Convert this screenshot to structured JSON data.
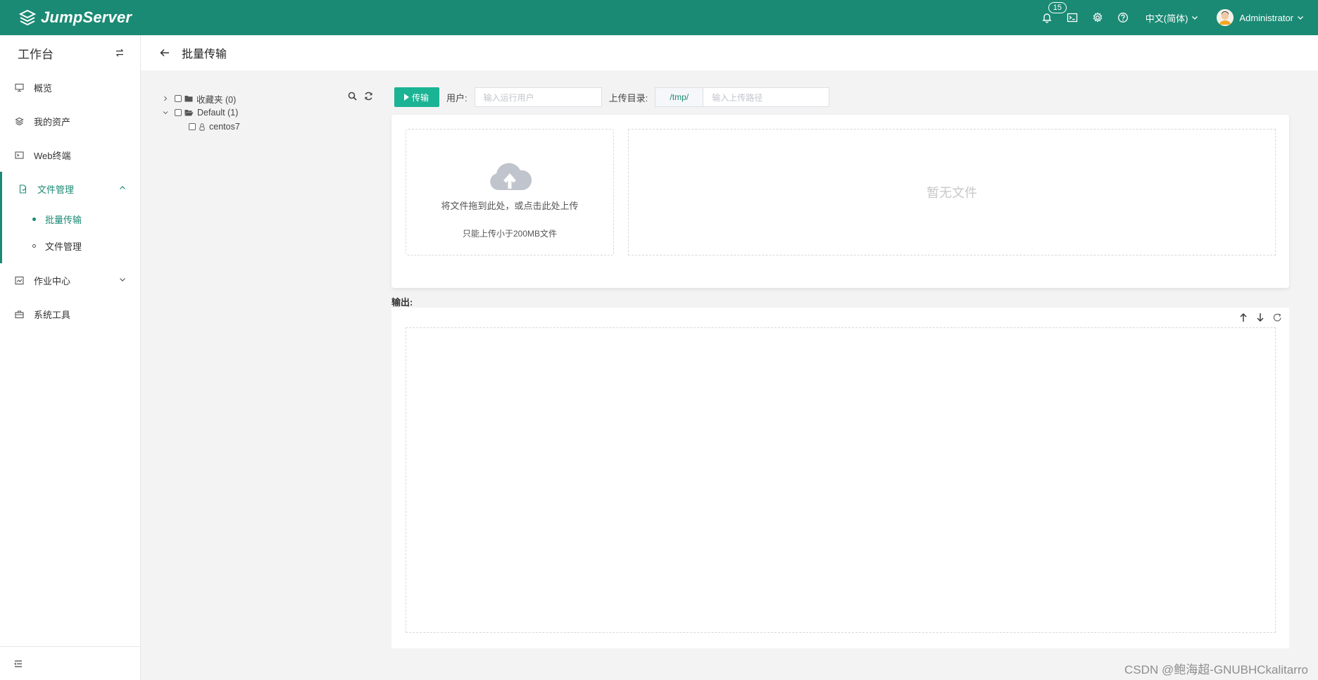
{
  "header": {
    "brand": "JumpServer",
    "notification_count": "15",
    "language": "中文(简体)",
    "username": "Administrator",
    "icons": [
      "bell-icon",
      "terminal-icon",
      "gear-icon",
      "help-icon"
    ],
    "bg_color": "#1a8a74"
  },
  "sidebar": {
    "workspace_title": "工作台",
    "items": [
      {
        "label": "概览",
        "icon": "monitor-icon"
      },
      {
        "label": "我的资产",
        "icon": "layers-icon"
      },
      {
        "label": "Web终端",
        "icon": "terminal-icon"
      },
      {
        "label": "文件管理",
        "icon": "file-icon",
        "expanded": true,
        "children": [
          {
            "label": "批量传输",
            "active": true
          },
          {
            "label": "文件管理",
            "active": false
          }
        ]
      },
      {
        "label": "作业中心",
        "icon": "job-icon"
      },
      {
        "label": "系统工具",
        "icon": "toolbox-icon"
      }
    ]
  },
  "page": {
    "title": "批量传输"
  },
  "tree": {
    "nodes": [
      {
        "label": "收藏夹 (0)",
        "expanded": false
      },
      {
        "label": "Default (1)",
        "expanded": true
      },
      {
        "label": "centos7",
        "type": "linux-asset"
      }
    ]
  },
  "toolbar": {
    "transfer_button": "传输",
    "user_label": "用户:",
    "user_placeholder": "输入运行用户",
    "dir_label": "上传目录:",
    "dir_prefix": "/tmp/",
    "dir_placeholder": "输入上传路径"
  },
  "upload": {
    "drop_text": "将文件拖到此处，或点击此处上传",
    "tip": "只能上传小于200MB文件",
    "empty_text": "暂无文件"
  },
  "output": {
    "label": "输出:"
  },
  "watermark": "CSDN @鲍海超-GNUBHCkalitarro"
}
